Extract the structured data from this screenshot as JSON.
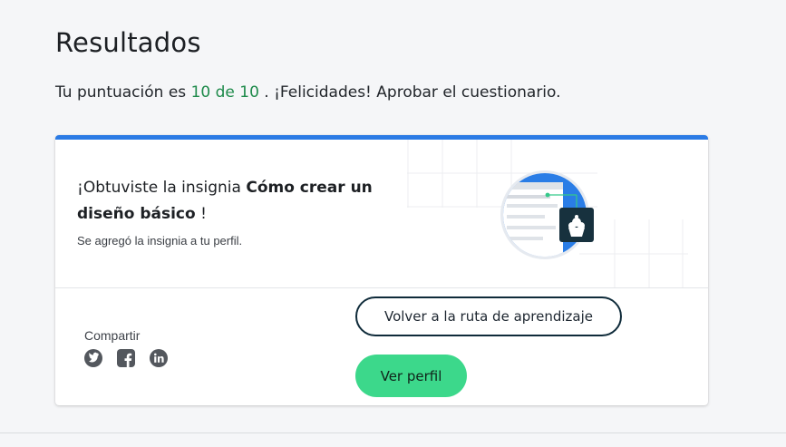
{
  "page": {
    "title": "Resultados",
    "score_prefix": "Tu puntuación es",
    "score_value": "10 de 10",
    "score_suffix": ". ¡Felicidades! Aprobar el cuestionario."
  },
  "badge_card": {
    "heading_prefix": "¡Obtuviste la insignia",
    "badge_name": "Cómo crear un diseño básico",
    "heading_suffix": "!",
    "subtitle": "Se agregó la insignia a tu perfil."
  },
  "share": {
    "label": "Compartir",
    "icons": [
      "twitter-icon",
      "facebook-icon",
      "linkedin-icon"
    ]
  },
  "actions": {
    "back_label": "Volver a la ruta de aprendizaje",
    "profile_label": "Ver perfil"
  },
  "colors": {
    "score_green": "#1d8a4a",
    "card_accent": "#2b7be5",
    "primary_button": "#3cd88b",
    "outline_button_border": "#0f2b3a"
  }
}
